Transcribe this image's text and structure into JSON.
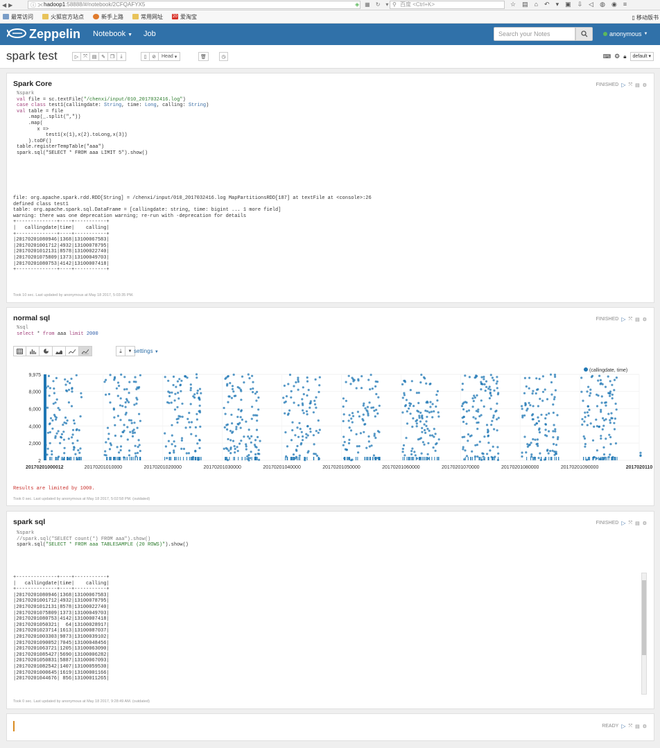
{
  "browser": {
    "url_host": "hadoop1",
    "url_rest": ":58888/#/notebook/2CFQAFYX5",
    "search_placeholder": "百度 <Ctrl+K>",
    "bookmarks": [
      "最常访问",
      "火狐官方站点",
      "新手上路",
      "常用网址",
      "爱淘宝"
    ],
    "bookmark_right": "移动版书",
    "bookmark_badge": "20"
  },
  "navbar": {
    "brand": "Zeppelin",
    "notebook_label": "Notebook",
    "job_label": "Job",
    "search_placeholder": "Search your Notes",
    "user": "anonymous"
  },
  "notebook": {
    "title": "spark test",
    "head_label": "Head",
    "interpreter": "default"
  },
  "paragraphs": [
    {
      "title": "Spark Core",
      "status": "FINISHED",
      "code": [
        "%spark",
        "",
        "val file = sc.textFile(\"/chenxi/input/010_2017032416.log\")",
        "",
        "case class test1(callingdate: String, time: Long, calling: String)",
        "",
        "val table = file",
        "    .map(_.split(\",\"))",
        "    .map(",
        "       x =>",
        "          test1(x(1),x(2).toLong,x(3))",
        "    ).toDF()",
        "",
        "table.registerTempTable(\"aaa\")",
        "",
        "spark.sql(\"SELECT * FROM aaa LIMIT 5\").show()"
      ],
      "output": [
        "file: org.apache.spark.rdd.RDD[String] = /chenxi/input/010_2017032416.log MapPartitionsRDD[187] at textFile at <console>:26",
        "defined class test1",
        "table: org.apache.spark.sql.DataFrame = [callingdate: string, time: bigint ... 1 more field]",
        "warning: there was one deprecation warning; re-run with -deprecation for details",
        "+--------------+----+-----------+",
        "|   callingdate|time|    calling|",
        "+--------------+----+-----------+",
        "|20170201080946|1368|13100067583|",
        "|20170201001712|4932|13100078795|",
        "|20170201012131|8578|13100022740|",
        "|20170201075809|1373|13100049703|",
        "|20170201080753|4142|13100007418|",
        "+--------------+----+-----------+"
      ],
      "footer": "Took 10 sec. Last updated by anonymous at May 18 2017, 5:03:35 PM."
    },
    {
      "title": "normal sql",
      "status": "FINISHED",
      "code": [
        "%sql",
        "",
        "select * from aaa limit 2000"
      ],
      "settings_label": "settings",
      "limit_message": "Results are limited by 1000.",
      "footer": "Took 0 sec. Last updated by anonymous at May 18 2017, 5:02:58 PM. (outdated)"
    },
    {
      "title": "spark sql",
      "status": "FINISHED",
      "code": [
        "%spark",
        "",
        "//spark.sql(\"SELECT count(*) FROM aaa\").show()",
        "",
        "",
        "spark.sql(\"SELECT * FROM aaa TABLESAMPLE (20 ROWS)\").show()"
      ],
      "output": [
        "+--------------+----+-----------+",
        "|   callingdate|time|    calling|",
        "+--------------+----+-----------+",
        "|20170201080946|1368|13100067583|",
        "|20170201001712|4932|13100078795|",
        "|20170201012131|8578|13100022740|",
        "|20170201075809|1373|13100049703|",
        "|20170201080753|4142|13100007418|",
        "|20170201050321|  64|13100028917|",
        "|20170201023714|1613|13100087037|",
        "|20170201003303|9873|13100039102|",
        "|20170201090052|7045|13100048456|",
        "|20170201063721|1205|13100063090|",
        "|20170201085427|5690|13100006282|",
        "|20170201050831|5887|13100067093|",
        "|20170201082542|1407|13100059530|",
        "|20170201000645|1619|13100001166|",
        "|20170201044676| 856|13100011265|"
      ],
      "footer": "Took 0 sec. Last updated by anonymous at May 18 2017, 9:28:49 AM. (outdated)"
    },
    {
      "status": "READY"
    }
  ],
  "chart_data": {
    "type": "scatter",
    "series": [
      {
        "name": "(callingdate, time)"
      }
    ],
    "xlabel": "",
    "ylabel": "",
    "ylim": [
      2,
      9975
    ],
    "yticks": [
      "9,975",
      "8,000",
      "6,000",
      "4,000",
      "2,000",
      "2"
    ],
    "xticks": [
      "20170201000012",
      "20170201010000",
      "20170201020000",
      "20170201030000",
      "20170201040000",
      "20170201050000",
      "20170201060000",
      "20170201070000",
      "20170201080000",
      "20170201090000",
      "2017020110"
    ],
    "point_count": 1000,
    "legend_position": "top-right",
    "color": "#1f77b4",
    "grid": true
  }
}
